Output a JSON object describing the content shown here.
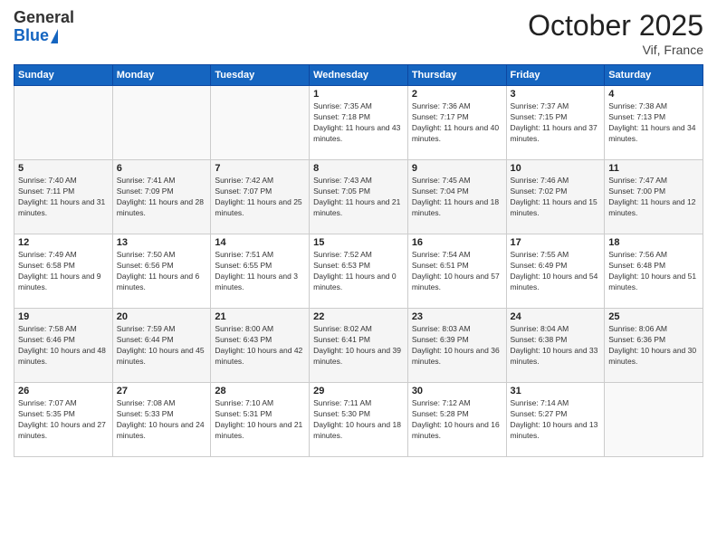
{
  "header": {
    "logo_general": "General",
    "logo_blue": "Blue",
    "month_title": "October 2025",
    "location": "Vif, France"
  },
  "days_of_week": [
    "Sunday",
    "Monday",
    "Tuesday",
    "Wednesday",
    "Thursday",
    "Friday",
    "Saturday"
  ],
  "weeks": [
    [
      {
        "num": "",
        "info": ""
      },
      {
        "num": "",
        "info": ""
      },
      {
        "num": "",
        "info": ""
      },
      {
        "num": "1",
        "info": "Sunrise: 7:35 AM\nSunset: 7:18 PM\nDaylight: 11 hours and 43 minutes."
      },
      {
        "num": "2",
        "info": "Sunrise: 7:36 AM\nSunset: 7:17 PM\nDaylight: 11 hours and 40 minutes."
      },
      {
        "num": "3",
        "info": "Sunrise: 7:37 AM\nSunset: 7:15 PM\nDaylight: 11 hours and 37 minutes."
      },
      {
        "num": "4",
        "info": "Sunrise: 7:38 AM\nSunset: 7:13 PM\nDaylight: 11 hours and 34 minutes."
      }
    ],
    [
      {
        "num": "5",
        "info": "Sunrise: 7:40 AM\nSunset: 7:11 PM\nDaylight: 11 hours and 31 minutes."
      },
      {
        "num": "6",
        "info": "Sunrise: 7:41 AM\nSunset: 7:09 PM\nDaylight: 11 hours and 28 minutes."
      },
      {
        "num": "7",
        "info": "Sunrise: 7:42 AM\nSunset: 7:07 PM\nDaylight: 11 hours and 25 minutes."
      },
      {
        "num": "8",
        "info": "Sunrise: 7:43 AM\nSunset: 7:05 PM\nDaylight: 11 hours and 21 minutes."
      },
      {
        "num": "9",
        "info": "Sunrise: 7:45 AM\nSunset: 7:04 PM\nDaylight: 11 hours and 18 minutes."
      },
      {
        "num": "10",
        "info": "Sunrise: 7:46 AM\nSunset: 7:02 PM\nDaylight: 11 hours and 15 minutes."
      },
      {
        "num": "11",
        "info": "Sunrise: 7:47 AM\nSunset: 7:00 PM\nDaylight: 11 hours and 12 minutes."
      }
    ],
    [
      {
        "num": "12",
        "info": "Sunrise: 7:49 AM\nSunset: 6:58 PM\nDaylight: 11 hours and 9 minutes."
      },
      {
        "num": "13",
        "info": "Sunrise: 7:50 AM\nSunset: 6:56 PM\nDaylight: 11 hours and 6 minutes."
      },
      {
        "num": "14",
        "info": "Sunrise: 7:51 AM\nSunset: 6:55 PM\nDaylight: 11 hours and 3 minutes."
      },
      {
        "num": "15",
        "info": "Sunrise: 7:52 AM\nSunset: 6:53 PM\nDaylight: 11 hours and 0 minutes."
      },
      {
        "num": "16",
        "info": "Sunrise: 7:54 AM\nSunset: 6:51 PM\nDaylight: 10 hours and 57 minutes."
      },
      {
        "num": "17",
        "info": "Sunrise: 7:55 AM\nSunset: 6:49 PM\nDaylight: 10 hours and 54 minutes."
      },
      {
        "num": "18",
        "info": "Sunrise: 7:56 AM\nSunset: 6:48 PM\nDaylight: 10 hours and 51 minutes."
      }
    ],
    [
      {
        "num": "19",
        "info": "Sunrise: 7:58 AM\nSunset: 6:46 PM\nDaylight: 10 hours and 48 minutes."
      },
      {
        "num": "20",
        "info": "Sunrise: 7:59 AM\nSunset: 6:44 PM\nDaylight: 10 hours and 45 minutes."
      },
      {
        "num": "21",
        "info": "Sunrise: 8:00 AM\nSunset: 6:43 PM\nDaylight: 10 hours and 42 minutes."
      },
      {
        "num": "22",
        "info": "Sunrise: 8:02 AM\nSunset: 6:41 PM\nDaylight: 10 hours and 39 minutes."
      },
      {
        "num": "23",
        "info": "Sunrise: 8:03 AM\nSunset: 6:39 PM\nDaylight: 10 hours and 36 minutes."
      },
      {
        "num": "24",
        "info": "Sunrise: 8:04 AM\nSunset: 6:38 PM\nDaylight: 10 hours and 33 minutes."
      },
      {
        "num": "25",
        "info": "Sunrise: 8:06 AM\nSunset: 6:36 PM\nDaylight: 10 hours and 30 minutes."
      }
    ],
    [
      {
        "num": "26",
        "info": "Sunrise: 7:07 AM\nSunset: 5:35 PM\nDaylight: 10 hours and 27 minutes."
      },
      {
        "num": "27",
        "info": "Sunrise: 7:08 AM\nSunset: 5:33 PM\nDaylight: 10 hours and 24 minutes."
      },
      {
        "num": "28",
        "info": "Sunrise: 7:10 AM\nSunset: 5:31 PM\nDaylight: 10 hours and 21 minutes."
      },
      {
        "num": "29",
        "info": "Sunrise: 7:11 AM\nSunset: 5:30 PM\nDaylight: 10 hours and 18 minutes."
      },
      {
        "num": "30",
        "info": "Sunrise: 7:12 AM\nSunset: 5:28 PM\nDaylight: 10 hours and 16 minutes."
      },
      {
        "num": "31",
        "info": "Sunrise: 7:14 AM\nSunset: 5:27 PM\nDaylight: 10 hours and 13 minutes."
      },
      {
        "num": "",
        "info": ""
      }
    ]
  ]
}
